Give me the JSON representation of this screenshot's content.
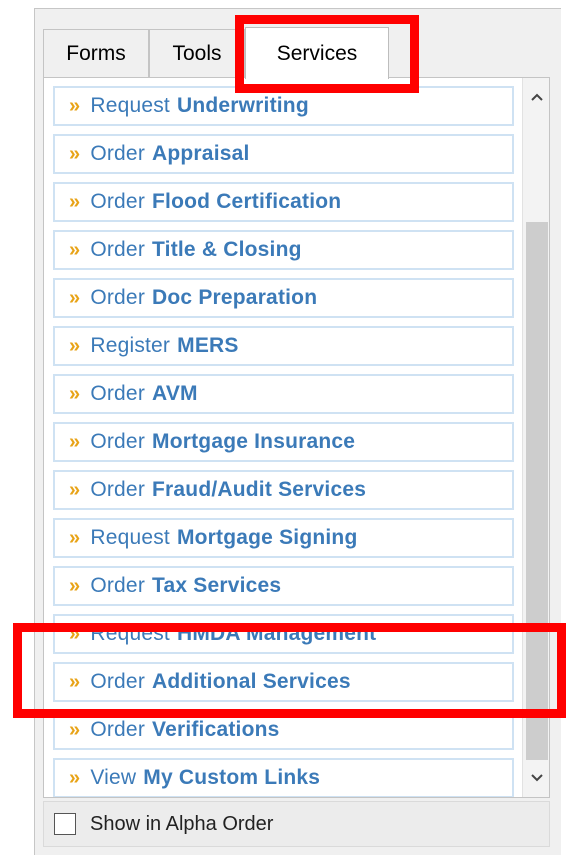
{
  "tabs": [
    {
      "label": "Forms"
    },
    {
      "label": "Tools"
    },
    {
      "label": "Services",
      "active": true
    }
  ],
  "services": [
    {
      "verb": "Request",
      "object": "Underwriting"
    },
    {
      "verb": "Order",
      "object": "Appraisal"
    },
    {
      "verb": "Order",
      "object": "Flood Certification"
    },
    {
      "verb": "Order",
      "object": "Title & Closing"
    },
    {
      "verb": "Order",
      "object": "Doc Preparation"
    },
    {
      "verb": "Register",
      "object": "MERS"
    },
    {
      "verb": "Order",
      "object": "AVM"
    },
    {
      "verb": "Order",
      "object": "Mortgage Insurance"
    },
    {
      "verb": "Order",
      "object": "Fraud/Audit Services"
    },
    {
      "verb": "Request",
      "object": "Mortgage Signing"
    },
    {
      "verb": "Order",
      "object": "Tax Services"
    },
    {
      "verb": "Request",
      "object": "HMDA Management"
    },
    {
      "verb": "Order",
      "object": "Additional Services"
    },
    {
      "verb": "Order",
      "object": "Verifications"
    },
    {
      "verb": "View",
      "object": "My Custom Links"
    }
  ],
  "list_bullet": "»",
  "footer": {
    "checkbox_label": "Show in Alpha Order",
    "checked": false
  },
  "colors": {
    "link": "#3b7ab8",
    "bullet": "#e8a317",
    "annotation": "#ff0000"
  }
}
